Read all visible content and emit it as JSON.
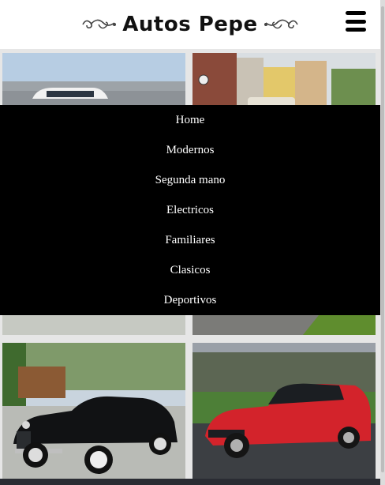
{
  "header": {
    "title": "Autos Pepe"
  },
  "menu": {
    "icon": "hamburger-menu-icon",
    "items": [
      {
        "label": "Home"
      },
      {
        "label": "Modernos"
      },
      {
        "label": "Segunda mano"
      },
      {
        "label": "Electricos"
      },
      {
        "label": "Familiares"
      },
      {
        "label": "Clasicos"
      },
      {
        "label": "Deportivos"
      }
    ]
  },
  "gallery": {
    "tiles": [
      {
        "subject": "white-classic-car-photo"
      },
      {
        "subject": "city-street-car-photo"
      },
      {
        "subject": "gray-car-photo"
      },
      {
        "subject": "dark-car-on-grass-photo"
      },
      {
        "subject": "black-vintage-convertible-photo"
      },
      {
        "subject": "red-hatchback-photo"
      }
    ]
  },
  "colors": {
    "header_bg": "#ffffff",
    "menu_bg": "#000000",
    "menu_text": "#ffffff",
    "page_bg": "#e6e6e6"
  }
}
